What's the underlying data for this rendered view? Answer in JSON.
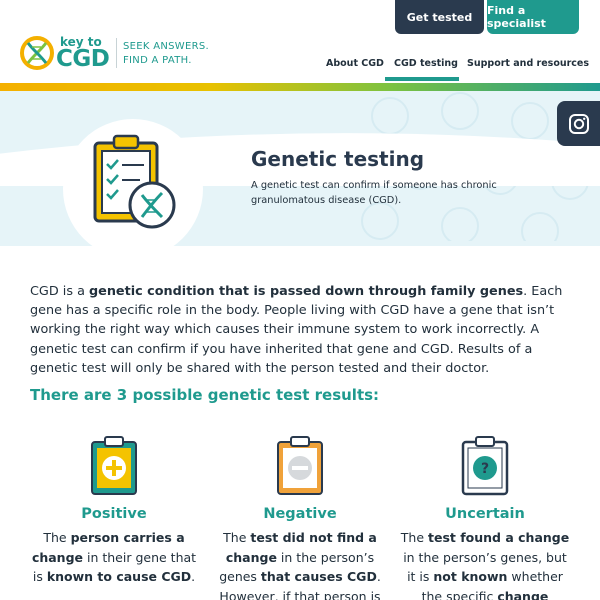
{
  "header": {
    "get_tested_label": "Get tested",
    "find_specialist_label": "Find a specialist",
    "logo_key": "key to",
    "logo_cgd": "CGD",
    "tagline_line1": "SEEK ANSWERS.",
    "tagline_line2": "FIND A PATH.",
    "nav": {
      "about": "About CGD",
      "testing": "CGD testing",
      "support": "Support and resources"
    }
  },
  "hero": {
    "title": "Genetic testing",
    "subtitle": "A genetic test can confirm if someone has chronic granulomatous disease (CGD)."
  },
  "intro": {
    "p1": "CGD is a ",
    "p1_bold": "genetic condition that is passed down through family genes",
    "p2": ". Each gene has a specific role in the body. People living with CGD have a gene that isn’t working the right way which causes their immune system to work incorrectly. A genetic test can confirm if you have inherited that gene and CGD. Results of a genetic test will only be shared with the person tested and their doctor."
  },
  "section_title": "There are 3 possible genetic test results:",
  "results": [
    {
      "title": "Positive",
      "parts": [
        "The ",
        "person carries a change",
        " in their gene that is ",
        "known to cause CGD",
        "."
      ],
      "icon": "plus-clipboard-icon",
      "color": "#f4c300"
    },
    {
      "title": "Negative",
      "parts": [
        "The ",
        "test did not find a change",
        " in the person’s genes ",
        "that causes CGD",
        ". However, if that person is"
      ],
      "icon": "minus-clipboard-icon",
      "color": "#f0a23a"
    },
    {
      "title": "Uncertain",
      "parts": [
        "The ",
        "test found a change",
        " in the person’s genes, but it is ",
        "not known",
        " whether the specific ",
        "change causes CGD",
        "."
      ],
      "icon": "question-clipboard-icon",
      "color": "#2a3a4e"
    }
  ],
  "colors": {
    "teal": "#1f9a8e",
    "navy": "#2a3a4e",
    "yellow": "#f4c300",
    "orange": "#f0a23a",
    "hero_bg": "#e6f4f8"
  }
}
